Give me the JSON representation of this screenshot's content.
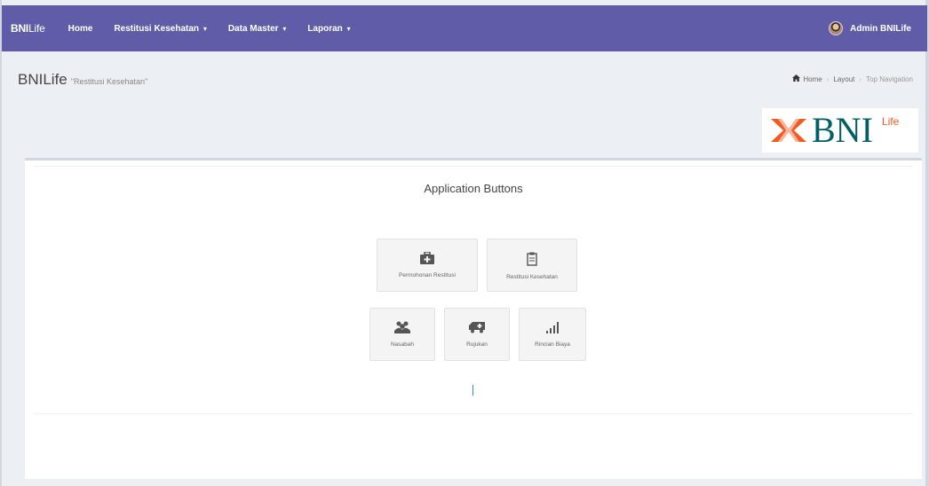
{
  "navbar": {
    "brand_bold": "BNI",
    "brand_rest": "Life",
    "items": [
      {
        "label": "Home",
        "caret": ""
      },
      {
        "label": "Restitusi Kesehatan",
        "caret": "▾"
      },
      {
        "label": "Data Master",
        "caret": "▾"
      },
      {
        "label": "Laporan",
        "caret": "▾"
      }
    ],
    "user": "Admin BNILife"
  },
  "header": {
    "title": "BNILife",
    "subtitle": "\"Restitusi Kesehatan\""
  },
  "breadcrumb": [
    "Home",
    "Layout",
    "Top Navigation"
  ],
  "logo": {
    "text": "BNI",
    "sup": "Life"
  },
  "box": {
    "title": "Application Buttons",
    "buttons": [
      {
        "label": "Permohonan Restitusi",
        "icon": "medkit-icon"
      },
      {
        "label": "Restitusi Kesehatan",
        "icon": "clipboard-icon"
      },
      {
        "label": "Nasabah",
        "icon": "users-icon"
      },
      {
        "label": "Rujukan",
        "icon": "ambulance-icon"
      },
      {
        "label": "Rincian Biaya",
        "icon": "signal-icon"
      }
    ]
  },
  "colors": {
    "navbar": "#605ca8",
    "logo_orange": "#f15a22",
    "logo_teal": "#006066"
  }
}
